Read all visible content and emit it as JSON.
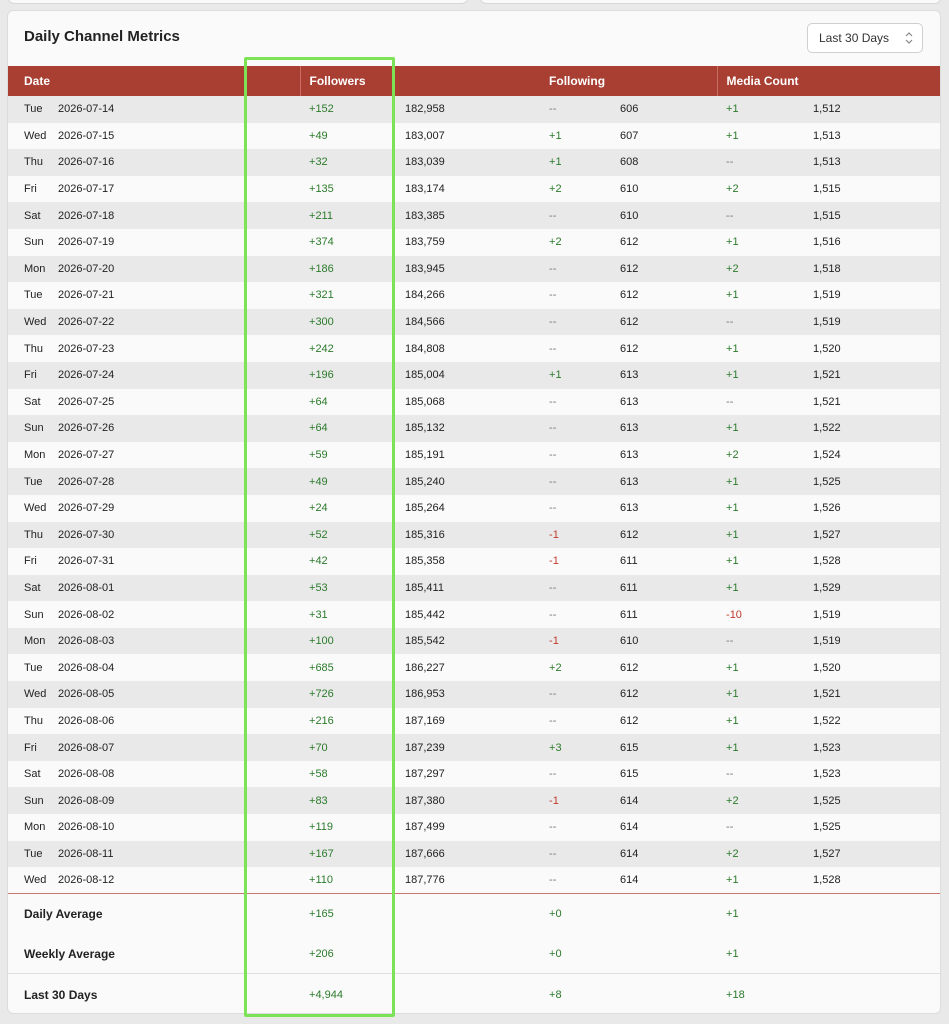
{
  "card": {
    "title": "Daily Channel Metrics",
    "range_select": {
      "value": "Last 30 Days"
    }
  },
  "columns": {
    "date": "Date",
    "followers": "Followers",
    "following": "Following",
    "media": "Media Count"
  },
  "rows": [
    {
      "dow": "Tue",
      "date": "2026-07-14",
      "f_delta": "+152",
      "f_total": "182,958",
      "g_delta": "--",
      "g_total": "606",
      "m_delta": "+1",
      "m_total": "1,512"
    },
    {
      "dow": "Wed",
      "date": "2026-07-15",
      "f_delta": "+49",
      "f_total": "183,007",
      "g_delta": "+1",
      "g_total": "607",
      "m_delta": "+1",
      "m_total": "1,513"
    },
    {
      "dow": "Thu",
      "date": "2026-07-16",
      "f_delta": "+32",
      "f_total": "183,039",
      "g_delta": "+1",
      "g_total": "608",
      "m_delta": "--",
      "m_total": "1,513"
    },
    {
      "dow": "Fri",
      "date": "2026-07-17",
      "f_delta": "+135",
      "f_total": "183,174",
      "g_delta": "+2",
      "g_total": "610",
      "m_delta": "+2",
      "m_total": "1,515"
    },
    {
      "dow": "Sat",
      "date": "2026-07-18",
      "f_delta": "+211",
      "f_total": "183,385",
      "g_delta": "--",
      "g_total": "610",
      "m_delta": "--",
      "m_total": "1,515"
    },
    {
      "dow": "Sun",
      "date": "2026-07-19",
      "f_delta": "+374",
      "f_total": "183,759",
      "g_delta": "+2",
      "g_total": "612",
      "m_delta": "+1",
      "m_total": "1,516"
    },
    {
      "dow": "Mon",
      "date": "2026-07-20",
      "f_delta": "+186",
      "f_total": "183,945",
      "g_delta": "--",
      "g_total": "612",
      "m_delta": "+2",
      "m_total": "1,518"
    },
    {
      "dow": "Tue",
      "date": "2026-07-21",
      "f_delta": "+321",
      "f_total": "184,266",
      "g_delta": "--",
      "g_total": "612",
      "m_delta": "+1",
      "m_total": "1,519"
    },
    {
      "dow": "Wed",
      "date": "2026-07-22",
      "f_delta": "+300",
      "f_total": "184,566",
      "g_delta": "--",
      "g_total": "612",
      "m_delta": "--",
      "m_total": "1,519"
    },
    {
      "dow": "Thu",
      "date": "2026-07-23",
      "f_delta": "+242",
      "f_total": "184,808",
      "g_delta": "--",
      "g_total": "612",
      "m_delta": "+1",
      "m_total": "1,520"
    },
    {
      "dow": "Fri",
      "date": "2026-07-24",
      "f_delta": "+196",
      "f_total": "185,004",
      "g_delta": "+1",
      "g_total": "613",
      "m_delta": "+1",
      "m_total": "1,521"
    },
    {
      "dow": "Sat",
      "date": "2026-07-25",
      "f_delta": "+64",
      "f_total": "185,068",
      "g_delta": "--",
      "g_total": "613",
      "m_delta": "--",
      "m_total": "1,521"
    },
    {
      "dow": "Sun",
      "date": "2026-07-26",
      "f_delta": "+64",
      "f_total": "185,132",
      "g_delta": "--",
      "g_total": "613",
      "m_delta": "+1",
      "m_total": "1,522"
    },
    {
      "dow": "Mon",
      "date": "2026-07-27",
      "f_delta": "+59",
      "f_total": "185,191",
      "g_delta": "--",
      "g_total": "613",
      "m_delta": "+2",
      "m_total": "1,524"
    },
    {
      "dow": "Tue",
      "date": "2026-07-28",
      "f_delta": "+49",
      "f_total": "185,240",
      "g_delta": "--",
      "g_total": "613",
      "m_delta": "+1",
      "m_total": "1,525"
    },
    {
      "dow": "Wed",
      "date": "2026-07-29",
      "f_delta": "+24",
      "f_total": "185,264",
      "g_delta": "--",
      "g_total": "613",
      "m_delta": "+1",
      "m_total": "1,526"
    },
    {
      "dow": "Thu",
      "date": "2026-07-30",
      "f_delta": "+52",
      "f_total": "185,316",
      "g_delta": "-1",
      "g_total": "612",
      "m_delta": "+1",
      "m_total": "1,527"
    },
    {
      "dow": "Fri",
      "date": "2026-07-31",
      "f_delta": "+42",
      "f_total": "185,358",
      "g_delta": "-1",
      "g_total": "611",
      "m_delta": "+1",
      "m_total": "1,528"
    },
    {
      "dow": "Sat",
      "date": "2026-08-01",
      "f_delta": "+53",
      "f_total": "185,411",
      "g_delta": "--",
      "g_total": "611",
      "m_delta": "+1",
      "m_total": "1,529"
    },
    {
      "dow": "Sun",
      "date": "2026-08-02",
      "f_delta": "+31",
      "f_total": "185,442",
      "g_delta": "--",
      "g_total": "611",
      "m_delta": "-10",
      "m_total": "1,519"
    },
    {
      "dow": "Mon",
      "date": "2026-08-03",
      "f_delta": "+100",
      "f_total": "185,542",
      "g_delta": "-1",
      "g_total": "610",
      "m_delta": "--",
      "m_total": "1,519"
    },
    {
      "dow": "Tue",
      "date": "2026-08-04",
      "f_delta": "+685",
      "f_total": "186,227",
      "g_delta": "+2",
      "g_total": "612",
      "m_delta": "+1",
      "m_total": "1,520"
    },
    {
      "dow": "Wed",
      "date": "2026-08-05",
      "f_delta": "+726",
      "f_total": "186,953",
      "g_delta": "--",
      "g_total": "612",
      "m_delta": "+1",
      "m_total": "1,521"
    },
    {
      "dow": "Thu",
      "date": "2026-08-06",
      "f_delta": "+216",
      "f_total": "187,169",
      "g_delta": "--",
      "g_total": "612",
      "m_delta": "+1",
      "m_total": "1,522"
    },
    {
      "dow": "Fri",
      "date": "2026-08-07",
      "f_delta": "+70",
      "f_total": "187,239",
      "g_delta": "+3",
      "g_total": "615",
      "m_delta": "+1",
      "m_total": "1,523"
    },
    {
      "dow": "Sat",
      "date": "2026-08-08",
      "f_delta": "+58",
      "f_total": "187,297",
      "g_delta": "--",
      "g_total": "615",
      "m_delta": "--",
      "m_total": "1,523"
    },
    {
      "dow": "Sun",
      "date": "2026-08-09",
      "f_delta": "+83",
      "f_total": "187,380",
      "g_delta": "-1",
      "g_total": "614",
      "m_delta": "+2",
      "m_total": "1,525"
    },
    {
      "dow": "Mon",
      "date": "2026-08-10",
      "f_delta": "+119",
      "f_total": "187,499",
      "g_delta": "--",
      "g_total": "614",
      "m_delta": "--",
      "m_total": "1,525"
    },
    {
      "dow": "Tue",
      "date": "2026-08-11",
      "f_delta": "+167",
      "f_total": "187,666",
      "g_delta": "--",
      "g_total": "614",
      "m_delta": "+2",
      "m_total": "1,527"
    },
    {
      "dow": "Wed",
      "date": "2026-08-12",
      "f_delta": "+110",
      "f_total": "187,776",
      "g_delta": "--",
      "g_total": "614",
      "m_delta": "+1",
      "m_total": "1,528"
    }
  ],
  "summary": [
    {
      "label": "Daily Average",
      "followers": "+165",
      "following": "+0",
      "media": "+1"
    },
    {
      "label": "Weekly Average",
      "followers": "+206",
      "following": "+0",
      "media": "+1"
    },
    {
      "label": "Last 30 Days",
      "followers": "+4,944",
      "following": "+8",
      "media": "+18"
    }
  ],
  "colors": {
    "header_bg": "#a93f33",
    "positive": "#2b7a2b",
    "negative": "#c0392b",
    "highlight": "#7de356"
  },
  "icons": {
    "range_select": "chevron-up-down-icon"
  }
}
